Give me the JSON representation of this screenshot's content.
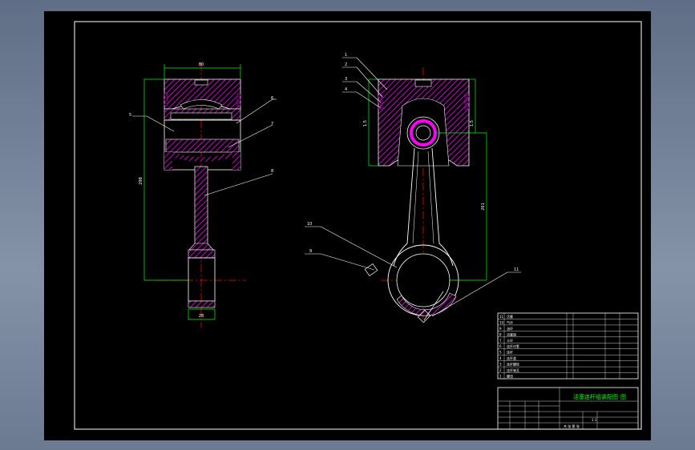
{
  "drawing": {
    "title": "活塞连杆组装配图",
    "title_suffix": "图",
    "colors": {
      "background": "#000000",
      "viewport": "#6b7a91",
      "border": "#ffffff",
      "hatch": "#ff00ff",
      "dimension": "#00ff00",
      "center_line": "#ff0000",
      "part_line": "#ffffff",
      "title_text": "#00ff00"
    },
    "dimensions": {
      "piston_width": "80",
      "overall_length": "298",
      "right_upper": "1.5",
      "right_middle": "1.5",
      "rod_length": "261",
      "pin_width": "28"
    },
    "balloons": {
      "left": [
        "5",
        "6",
        "7",
        "8"
      ],
      "right": [
        "1",
        "2",
        "3",
        "4",
        "10",
        "9",
        "11"
      ]
    },
    "parts_list": [
      "活塞",
      "气环",
      "油环",
      "活塞销",
      "卡环",
      "连杆衬套",
      "连杆",
      "连杆盖",
      "连杆螺栓",
      "连杆轴瓦",
      "螺母"
    ],
    "title_block": {
      "scale": "1:1",
      "sheet_label": "共 张 第 张"
    }
  }
}
